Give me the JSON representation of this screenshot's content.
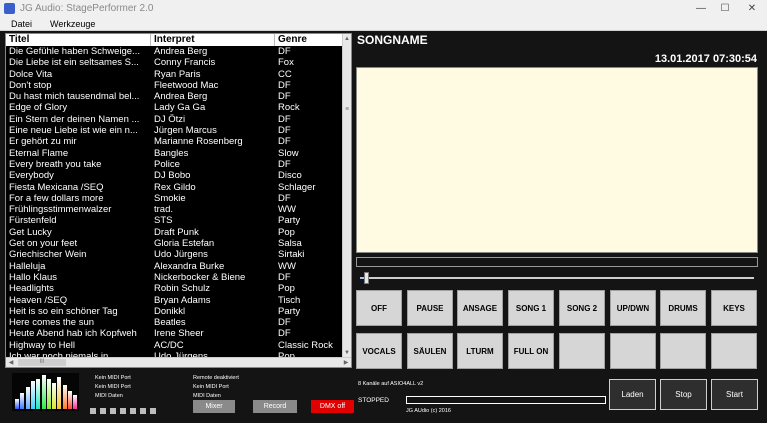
{
  "window": {
    "title": "JG Audio: StagePerformer 2.0",
    "minimize": "—",
    "maximize": "☐",
    "close": "✕"
  },
  "menu": {
    "items": [
      "Datei",
      "Werkzeuge"
    ]
  },
  "song_list": {
    "columns": [
      "Titel",
      "Interpret",
      "Genre"
    ],
    "rows": [
      [
        "Die Gefühle haben Schweige...",
        "Andrea Berg",
        "DF"
      ],
      [
        "Die Liebe ist ein seltsames S...",
        "Conny Francis",
        "Fox"
      ],
      [
        "Dolce Vita",
        "Ryan Paris",
        "CC"
      ],
      [
        "Don't stop",
        "Fleetwood Mac",
        "DF"
      ],
      [
        "Du hast mich tausendmal bel...",
        "Andrea Berg",
        "DF"
      ],
      [
        "Edge of Glory",
        "Lady Ga Ga",
        "Rock"
      ],
      [
        "Ein Stern der deinen Namen ...",
        "DJ Ötzi",
        "DF"
      ],
      [
        "Eine neue Liebe ist wie ein n...",
        "Jürgen Marcus",
        "DF"
      ],
      [
        "Er gehört zu mir",
        "Marianne Rosenberg",
        "DF"
      ],
      [
        "Eternal Flame",
        "Bangles",
        "Slow"
      ],
      [
        "Every breath you take",
        "Police",
        "DF"
      ],
      [
        "Everybody",
        "DJ Bobo",
        "Disco"
      ],
      [
        "Fiesta Mexicana /SEQ",
        "Rex Gildo",
        "Schlager"
      ],
      [
        "For a few dollars more",
        "Smokie",
        "DF"
      ],
      [
        "Frühlingsstimmenwalzer",
        "trad.",
        "WW"
      ],
      [
        "Fürstenfeld",
        "STS",
        "Party"
      ],
      [
        "Get Lucky",
        "Draft Punk",
        "Pop"
      ],
      [
        "Get on your feet",
        "Gloria Estefan",
        "Salsa"
      ],
      [
        "Griechischer Wein",
        "Udo Jürgens",
        "Sirtaki"
      ],
      [
        "Halleluja",
        "Alexandra Burke",
        "WW"
      ],
      [
        "Hallo Klaus",
        "Nickerbocker & Biene",
        "DF"
      ],
      [
        "Headlights",
        "Robin Schulz",
        "Pop"
      ],
      [
        "Heaven /SEQ",
        "Bryan Adams",
        "Tisch"
      ],
      [
        "Heit is so ein schöner Tag",
        "Donikkl",
        "Party"
      ],
      [
        "Here comes the sun",
        "Beatles",
        "DF"
      ],
      [
        "Heute Abend hab ich Kopfweh",
        "Irene Sheer",
        "DF"
      ],
      [
        "Highway to Hell",
        "AC/DC",
        "Classic Rock"
      ],
      [
        "Ich war noch niemals in...",
        "Udo Jürgens",
        "Pop"
      ]
    ],
    "scroll_grip": "≡",
    "h_grip": "III"
  },
  "display": {
    "songname": "SONGNAME",
    "datetime": "13.01.2017 07:30:54",
    "slider_position": 0.01
  },
  "controls": {
    "row1": [
      "OFF",
      "PAUSE",
      "ANSAGE",
      "SONG 1",
      "SONG 2",
      "UP/DWN",
      "DRUMS",
      "KEYS"
    ],
    "row2": [
      "VOCALS",
      "SÄULEN",
      "LTURM",
      "FULL ON",
      "",
      "",
      "",
      ""
    ]
  },
  "bottom": {
    "midi_status": [
      "Kein MIDI Port",
      "Kein MIDI Port",
      "MIDI Daten"
    ],
    "remote_status": [
      "Remote deaktiviert",
      "Kein MIDI Port",
      "MIDI Daten"
    ],
    "buttons": {
      "mixer": "Mixer",
      "record": "Record",
      "dmx": "DMX off"
    },
    "channels_info": "8 Kanäle auf ASIO4ALL v2",
    "playback_state": "STOPPED",
    "copyright": "JG AUdio (c) 2016",
    "actions": {
      "load": "Laden",
      "stop": "Stop",
      "start": "Start"
    }
  },
  "colors": {
    "background": "#141414",
    "lyric_bg": "#fffbe3",
    "dmx_button": "#e00000",
    "control_button": "#d6d6d6",
    "dark_button": "#2e2e2e"
  }
}
